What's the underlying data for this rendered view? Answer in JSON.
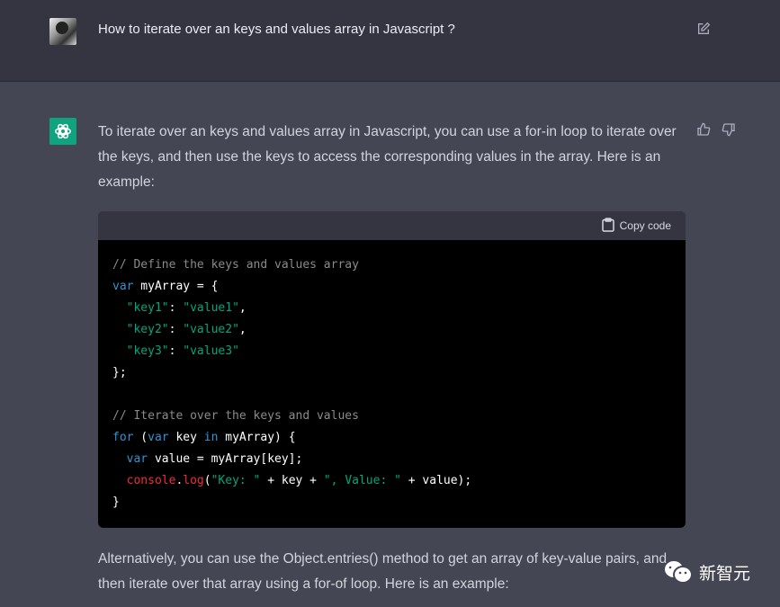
{
  "user": {
    "question": "How to iterate over an keys and values array in Javascript ?"
  },
  "assistant": {
    "intro": "To iterate over an keys and values array in Javascript, you can use a for-in loop to iterate over the keys, and then use the keys to access the corresponding values in the array. Here is an example:",
    "copy_label": "Copy code",
    "code_lines": [
      [
        [
          "// Define the keys and values array",
          "cm"
        ]
      ],
      [
        [
          "var",
          "kw"
        ],
        [
          " myArray = {",
          "id"
        ]
      ],
      [
        [
          "  ",
          "id"
        ],
        [
          "\"key1\"",
          "st"
        ],
        [
          ": ",
          "id"
        ],
        [
          "\"value1\"",
          "st"
        ],
        [
          ",",
          "id"
        ]
      ],
      [
        [
          "  ",
          "id"
        ],
        [
          "\"key2\"",
          "st"
        ],
        [
          ": ",
          "id"
        ],
        [
          "\"value2\"",
          "st"
        ],
        [
          ",",
          "id"
        ]
      ],
      [
        [
          "  ",
          "id"
        ],
        [
          "\"key3\"",
          "st"
        ],
        [
          ": ",
          "id"
        ],
        [
          "\"value3\"",
          "st"
        ]
      ],
      [
        [
          "};",
          "id"
        ]
      ],
      [
        [
          "",
          "id"
        ]
      ],
      [
        [
          "// Iterate over the keys and values",
          "cm"
        ]
      ],
      [
        [
          "for",
          "kw"
        ],
        [
          " (",
          "id"
        ],
        [
          "var",
          "kw"
        ],
        [
          " key ",
          "id"
        ],
        [
          "in",
          "kw"
        ],
        [
          " myArray) {",
          "id"
        ]
      ],
      [
        [
          "  ",
          "id"
        ],
        [
          "var",
          "kw"
        ],
        [
          " value = myArray[key];",
          "id"
        ]
      ],
      [
        [
          "  ",
          "id"
        ],
        [
          "console",
          "fn"
        ],
        [
          ".",
          "id"
        ],
        [
          "log",
          "fn"
        ],
        [
          "(",
          "id"
        ],
        [
          "\"Key: \"",
          "st"
        ],
        [
          " + key + ",
          "id"
        ],
        [
          "\", Value: \"",
          "st"
        ],
        [
          " + value);",
          "id"
        ]
      ],
      [
        [
          "}",
          "id"
        ]
      ]
    ],
    "followup": "Alternatively, you can use the Object.entries() method to get an array of key-value pairs, and then iterate over that array using a for-of loop. Here is an example:"
  },
  "watermark": "新智元",
  "colors": {
    "user_bg": "#343541",
    "assistant_bg": "#444654",
    "accent": "#10a37f"
  }
}
